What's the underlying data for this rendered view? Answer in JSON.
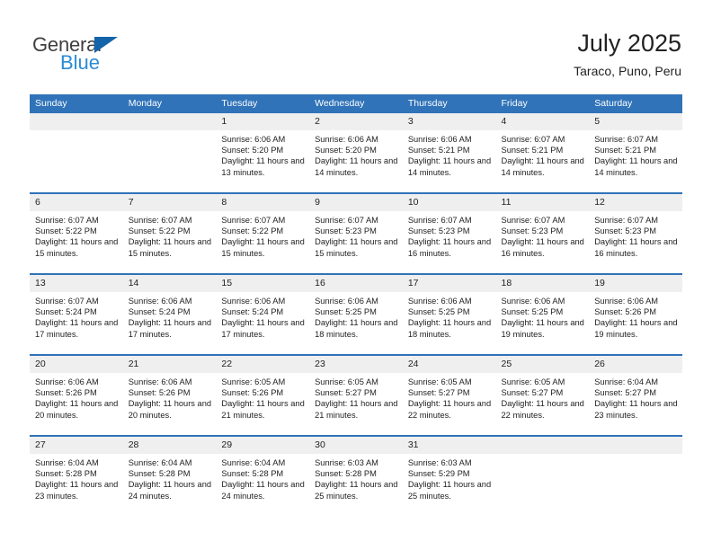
{
  "brand": {
    "name_part1": "General",
    "name_part2": "Blue",
    "triangle_icon": "triangle-icon",
    "colors": {
      "general": "#3f3f3f",
      "blue": "#2a8cd6",
      "triangle": "#1464aa"
    }
  },
  "header": {
    "title": "July 2025",
    "subtitle": "Taraco, Puno, Peru"
  },
  "theme": {
    "header_blue": "#3073b8",
    "date_band_gray": "#efefef",
    "separator_blue": "#3073b8"
  },
  "weekday_headers": [
    "Sunday",
    "Monday",
    "Tuesday",
    "Wednesday",
    "Thursday",
    "Friday",
    "Saturday"
  ],
  "weeks": [
    {
      "days": [
        {
          "date": "",
          "empty": true,
          "sunrise": "",
          "sunset": "",
          "daylight": ""
        },
        {
          "date": "",
          "empty": true,
          "sunrise": "",
          "sunset": "",
          "daylight": ""
        },
        {
          "date": "1",
          "empty": false,
          "sunrise": "Sunrise: 6:06 AM",
          "sunset": "Sunset: 5:20 PM",
          "daylight": "Daylight: 11 hours and 13 minutes."
        },
        {
          "date": "2",
          "empty": false,
          "sunrise": "Sunrise: 6:06 AM",
          "sunset": "Sunset: 5:20 PM",
          "daylight": "Daylight: 11 hours and 14 minutes."
        },
        {
          "date": "3",
          "empty": false,
          "sunrise": "Sunrise: 6:06 AM",
          "sunset": "Sunset: 5:21 PM",
          "daylight": "Daylight: 11 hours and 14 minutes."
        },
        {
          "date": "4",
          "empty": false,
          "sunrise": "Sunrise: 6:07 AM",
          "sunset": "Sunset: 5:21 PM",
          "daylight": "Daylight: 11 hours and 14 minutes."
        },
        {
          "date": "5",
          "empty": false,
          "sunrise": "Sunrise: 6:07 AM",
          "sunset": "Sunset: 5:21 PM",
          "daylight": "Daylight: 11 hours and 14 minutes."
        }
      ]
    },
    {
      "days": [
        {
          "date": "6",
          "empty": false,
          "sunrise": "Sunrise: 6:07 AM",
          "sunset": "Sunset: 5:22 PM",
          "daylight": "Daylight: 11 hours and 15 minutes."
        },
        {
          "date": "7",
          "empty": false,
          "sunrise": "Sunrise: 6:07 AM",
          "sunset": "Sunset: 5:22 PM",
          "daylight": "Daylight: 11 hours and 15 minutes."
        },
        {
          "date": "8",
          "empty": false,
          "sunrise": "Sunrise: 6:07 AM",
          "sunset": "Sunset: 5:22 PM",
          "daylight": "Daylight: 11 hours and 15 minutes."
        },
        {
          "date": "9",
          "empty": false,
          "sunrise": "Sunrise: 6:07 AM",
          "sunset": "Sunset: 5:23 PM",
          "daylight": "Daylight: 11 hours and 15 minutes."
        },
        {
          "date": "10",
          "empty": false,
          "sunrise": "Sunrise: 6:07 AM",
          "sunset": "Sunset: 5:23 PM",
          "daylight": "Daylight: 11 hours and 16 minutes."
        },
        {
          "date": "11",
          "empty": false,
          "sunrise": "Sunrise: 6:07 AM",
          "sunset": "Sunset: 5:23 PM",
          "daylight": "Daylight: 11 hours and 16 minutes."
        },
        {
          "date": "12",
          "empty": false,
          "sunrise": "Sunrise: 6:07 AM",
          "sunset": "Sunset: 5:23 PM",
          "daylight": "Daylight: 11 hours and 16 minutes."
        }
      ]
    },
    {
      "days": [
        {
          "date": "13",
          "empty": false,
          "sunrise": "Sunrise: 6:07 AM",
          "sunset": "Sunset: 5:24 PM",
          "daylight": "Daylight: 11 hours and 17 minutes."
        },
        {
          "date": "14",
          "empty": false,
          "sunrise": "Sunrise: 6:06 AM",
          "sunset": "Sunset: 5:24 PM",
          "daylight": "Daylight: 11 hours and 17 minutes."
        },
        {
          "date": "15",
          "empty": false,
          "sunrise": "Sunrise: 6:06 AM",
          "sunset": "Sunset: 5:24 PM",
          "daylight": "Daylight: 11 hours and 17 minutes."
        },
        {
          "date": "16",
          "empty": false,
          "sunrise": "Sunrise: 6:06 AM",
          "sunset": "Sunset: 5:25 PM",
          "daylight": "Daylight: 11 hours and 18 minutes."
        },
        {
          "date": "17",
          "empty": false,
          "sunrise": "Sunrise: 6:06 AM",
          "sunset": "Sunset: 5:25 PM",
          "daylight": "Daylight: 11 hours and 18 minutes."
        },
        {
          "date": "18",
          "empty": false,
          "sunrise": "Sunrise: 6:06 AM",
          "sunset": "Sunset: 5:25 PM",
          "daylight": "Daylight: 11 hours and 19 minutes."
        },
        {
          "date": "19",
          "empty": false,
          "sunrise": "Sunrise: 6:06 AM",
          "sunset": "Sunset: 5:26 PM",
          "daylight": "Daylight: 11 hours and 19 minutes."
        }
      ]
    },
    {
      "days": [
        {
          "date": "20",
          "empty": false,
          "sunrise": "Sunrise: 6:06 AM",
          "sunset": "Sunset: 5:26 PM",
          "daylight": "Daylight: 11 hours and 20 minutes."
        },
        {
          "date": "21",
          "empty": false,
          "sunrise": "Sunrise: 6:06 AM",
          "sunset": "Sunset: 5:26 PM",
          "daylight": "Daylight: 11 hours and 20 minutes."
        },
        {
          "date": "22",
          "empty": false,
          "sunrise": "Sunrise: 6:05 AM",
          "sunset": "Sunset: 5:26 PM",
          "daylight": "Daylight: 11 hours and 21 minutes."
        },
        {
          "date": "23",
          "empty": false,
          "sunrise": "Sunrise: 6:05 AM",
          "sunset": "Sunset: 5:27 PM",
          "daylight": "Daylight: 11 hours and 21 minutes."
        },
        {
          "date": "24",
          "empty": false,
          "sunrise": "Sunrise: 6:05 AM",
          "sunset": "Sunset: 5:27 PM",
          "daylight": "Daylight: 11 hours and 22 minutes."
        },
        {
          "date": "25",
          "empty": false,
          "sunrise": "Sunrise: 6:05 AM",
          "sunset": "Sunset: 5:27 PM",
          "daylight": "Daylight: 11 hours and 22 minutes."
        },
        {
          "date": "26",
          "empty": false,
          "sunrise": "Sunrise: 6:04 AM",
          "sunset": "Sunset: 5:27 PM",
          "daylight": "Daylight: 11 hours and 23 minutes."
        }
      ]
    },
    {
      "days": [
        {
          "date": "27",
          "empty": false,
          "sunrise": "Sunrise: 6:04 AM",
          "sunset": "Sunset: 5:28 PM",
          "daylight": "Daylight: 11 hours and 23 minutes."
        },
        {
          "date": "28",
          "empty": false,
          "sunrise": "Sunrise: 6:04 AM",
          "sunset": "Sunset: 5:28 PM",
          "daylight": "Daylight: 11 hours and 24 minutes."
        },
        {
          "date": "29",
          "empty": false,
          "sunrise": "Sunrise: 6:04 AM",
          "sunset": "Sunset: 5:28 PM",
          "daylight": "Daylight: 11 hours and 24 minutes."
        },
        {
          "date": "30",
          "empty": false,
          "sunrise": "Sunrise: 6:03 AM",
          "sunset": "Sunset: 5:28 PM",
          "daylight": "Daylight: 11 hours and 25 minutes."
        },
        {
          "date": "31",
          "empty": false,
          "sunrise": "Sunrise: 6:03 AM",
          "sunset": "Sunset: 5:29 PM",
          "daylight": "Daylight: 11 hours and 25 minutes."
        },
        {
          "date": "",
          "empty": true,
          "sunrise": "",
          "sunset": "",
          "daylight": ""
        },
        {
          "date": "",
          "empty": true,
          "sunrise": "",
          "sunset": "",
          "daylight": ""
        }
      ]
    }
  ]
}
